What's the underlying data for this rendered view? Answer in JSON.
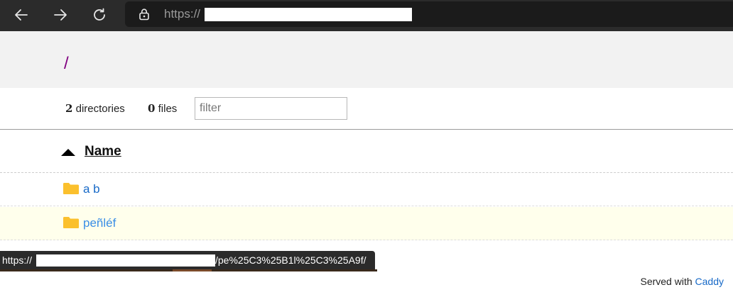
{
  "browser": {
    "back_icon": "arrow-left-icon",
    "forward_icon": "arrow-right-icon",
    "reload_icon": "reload-icon",
    "lock_icon": "lock-icon",
    "url_scheme": "https://"
  },
  "page": {
    "breadcrumb": "/",
    "counts": {
      "directories_num": "2",
      "directories_label": "directories",
      "files_num": "0",
      "files_label": "files"
    },
    "filter": {
      "placeholder": "filter",
      "value": ""
    },
    "table": {
      "sort_icon": "triangle-up-icon",
      "name_header": "Name",
      "rows": [
        {
          "name": "a b",
          "icon": "folder-icon"
        },
        {
          "name": "peñléf",
          "icon": "folder-icon"
        }
      ]
    },
    "footer": {
      "prefix": "Served with",
      "link": "Caddy"
    }
  },
  "status_bubble": {
    "prefix": "https://",
    "suffix": "/pe%25C3%25B1l%25C3%25A9f/"
  },
  "colors": {
    "toolbar": "#2b2b2b",
    "link": "#1769c7",
    "breadcrumb": "#800080",
    "folder": "#fbc02d",
    "hover_row": "#ffffec"
  }
}
